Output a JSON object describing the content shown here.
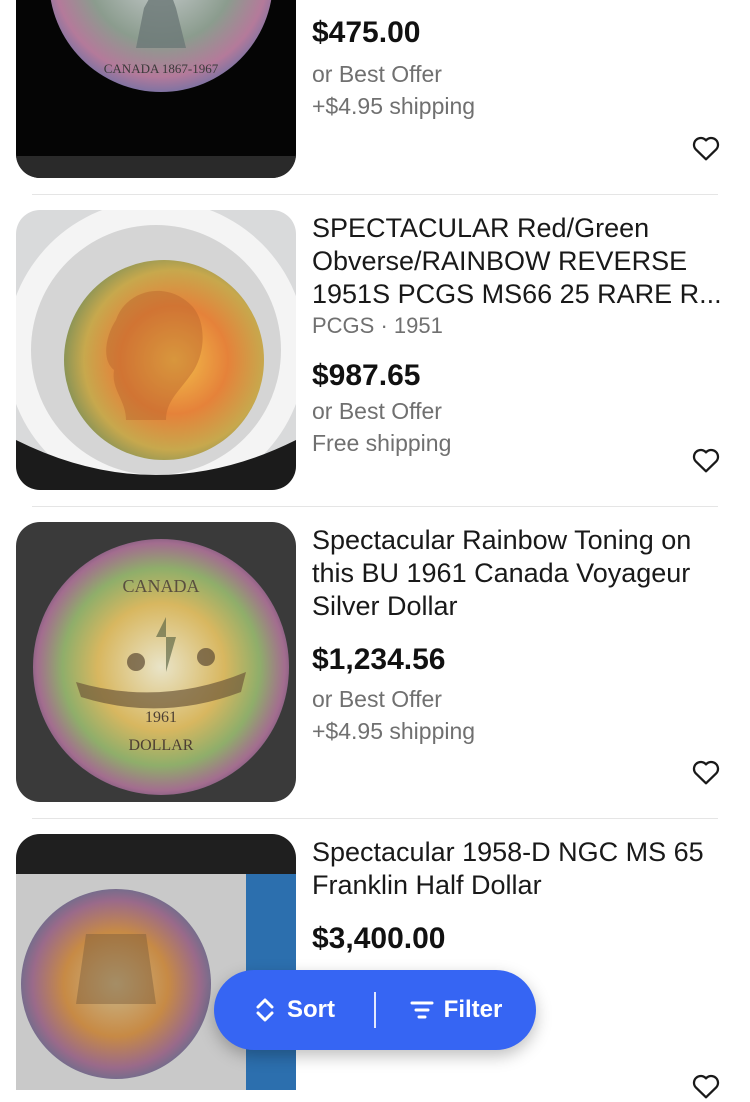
{
  "listings": [
    {
      "title": "",
      "subtitle": "",
      "price": "$475.00",
      "offer": "or Best Offer",
      "shipping": "+$4.95 shipping",
      "image": "coin-wolf-canada-1867-1967-icon"
    },
    {
      "title": "SPECTACULAR Red/Green Obverse/RAINBOW REVERSE 1951S PCGS MS66 25 RARE R...",
      "subtitle": "PCGS · 1951",
      "price": "$987.65",
      "offer": "or Best Offer",
      "shipping": "Free shipping",
      "image": "coin-washington-quarter-icon"
    },
    {
      "title": "Spectacular Rainbow Toning on this BU 1961 Canada Voyageur Silver Dollar",
      "subtitle": "",
      "price": "$1,234.56",
      "offer": "or Best Offer",
      "shipping": "+$4.95 shipping",
      "image": "coin-canada-voyageur-dollar-icon"
    },
    {
      "title": "Spectacular 1958-D NGC MS 65 Franklin Half Dollar",
      "subtitle": "",
      "price": "$3,400.00",
      "offer": "",
      "shipping": "",
      "image": "coin-franklin-half-dollar-icon"
    }
  ],
  "coin_text": {
    "l0": "CANADA 1867-1967",
    "l2a": "CANADA",
    "l2b": "1961",
    "l2c": "DOLLAR"
  },
  "action_bar": {
    "sort_label": "Sort",
    "filter_label": "Filter"
  },
  "colors": {
    "accent": "#3665f3",
    "text": "#191919",
    "muted": "#707070"
  }
}
